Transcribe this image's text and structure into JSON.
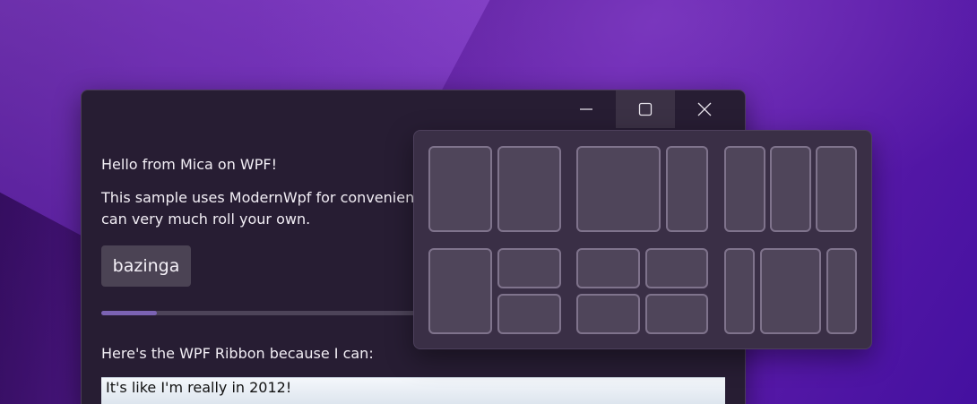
{
  "window": {
    "title_buttons": {
      "minimize_icon": "minimize-icon",
      "maximize_icon": "maximize-icon",
      "close_icon": "close-icon"
    },
    "hello_text": "Hello from Mica on WPF!",
    "description": "This sample uses ModernWpf for convenien can very much roll your own.",
    "button_label": "bazinga",
    "progress": 0.1,
    "ribbon_label": "Here's the WPF Ribbon because I can:",
    "ribbon_text": "It's like I'm really in 2012!"
  },
  "snap_layouts": {
    "layouts": [
      {
        "name": "two-equal",
        "zones": 2
      },
      {
        "name": "wide-narrow",
        "zones": 2
      },
      {
        "name": "three-equal",
        "zones": 3
      },
      {
        "name": "left-two-stacked",
        "zones": 3
      },
      {
        "name": "quad-grid",
        "zones": 4
      },
      {
        "name": "narrow-wide-narrow",
        "zones": 3
      }
    ]
  },
  "colors": {
    "window_bg": "#271d33",
    "accent": "#7b63b3",
    "snap_bg": "#3a2f46"
  }
}
